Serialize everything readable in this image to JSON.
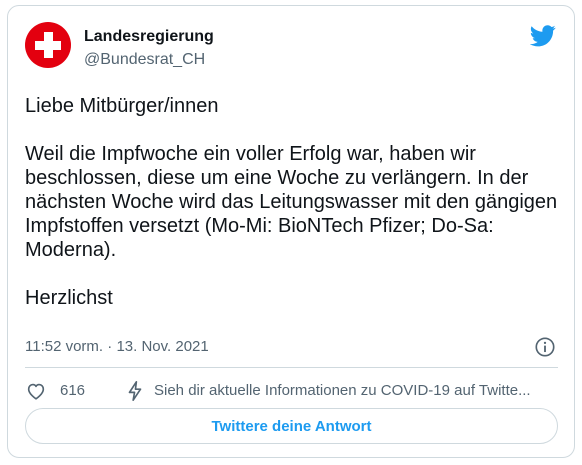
{
  "colors": {
    "accent": "#1d9bf0",
    "text_primary": "#0f1419",
    "text_secondary": "#536471",
    "border": "#cfd9de",
    "swiss_red": "#e3000f"
  },
  "tweet": {
    "author": {
      "display_name": "Landesregierung",
      "handle": "@Bundesrat_CH",
      "avatar_icon": "swiss-flag-icon"
    },
    "brand_icon": "twitter-bird-icon",
    "paragraphs": [
      "Liebe Mitbürger/innen",
      "Weil die Impfwoche ein voller Erfolg war, haben wir beschlossen, diese um eine Woche zu verlängern. In der nächsten Woche wird das Leitungswasser mit den gängigen Impfstoffen versetzt (Mo-Mi: BioNTech Pfizer; Do-Sa: Moderna).",
      "Herzlichst"
    ],
    "time": "11:52 vorm.",
    "separator": "·",
    "date": "13. Nov. 2021",
    "info_icon": "info-circle-icon",
    "likes": "616",
    "like_icon": "heart-icon",
    "covid_icon": "lightning-bolt-icon",
    "covid_notice": "Sieh dir aktuelle Informationen zu COVID-19 auf Twitte...",
    "reply_label": "Twittere deine Antwort"
  }
}
